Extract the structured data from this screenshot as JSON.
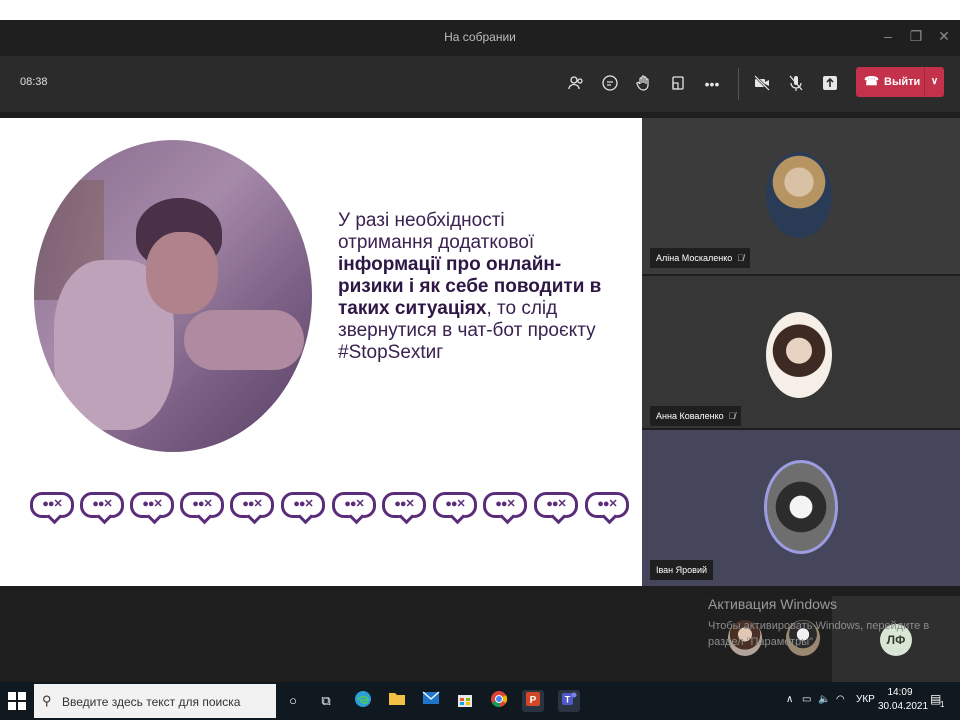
{
  "window": {
    "title": "На собрании",
    "minimize": "–",
    "restore": "❐",
    "close": "✕"
  },
  "toolbar": {
    "timer": "08:38",
    "icons": [
      "people-icon",
      "chat-icon",
      "raise-hand-icon",
      "rooms-icon",
      "more-icon",
      "camera-off-icon",
      "mic-off-icon",
      "share-icon"
    ],
    "leave_label": "Выйти"
  },
  "slide": {
    "line1": "У разі необхідності",
    "line2": "отримання додаткової",
    "line3_bold": "інформації про онлайн-",
    "line4_bold": "ризики і як себе поводити в",
    "line5_bold": "таких ситуаціях",
    "line5_rest": ", то слід",
    "line6": "звернутися в чат-бот проєкту",
    "line7": "#StopSextиг",
    "bubble_glyph": "●●✕"
  },
  "participants": [
    {
      "name": "Аліна Москаленко",
      "muted": true
    },
    {
      "name": "Анна Коваленко",
      "muted": true
    },
    {
      "name": "Іван Яровий",
      "muted": false
    }
  ],
  "watermark": {
    "title": "Активация Windows",
    "text": "Чтобы активировать Windows, перейдите в раздел \"Параметры\""
  },
  "initials_tile": "ЛФ",
  "taskbar": {
    "search_placeholder": "Введите здесь текст для поиска",
    "apps": [
      "cortana-icon",
      "task-view-icon",
      "edge-icon",
      "file-explorer-icon",
      "mail-icon",
      "store-icon",
      "chrome-icon",
      "powerpoint-icon",
      "teams-icon"
    ],
    "tray_lang": "УКР",
    "time": "14:09",
    "date": "30.04.2021",
    "notif_count": "1"
  },
  "colors": {
    "leave": "#c4314b",
    "slide_text": "#3a2150",
    "bubble": "#5a2c7a"
  }
}
